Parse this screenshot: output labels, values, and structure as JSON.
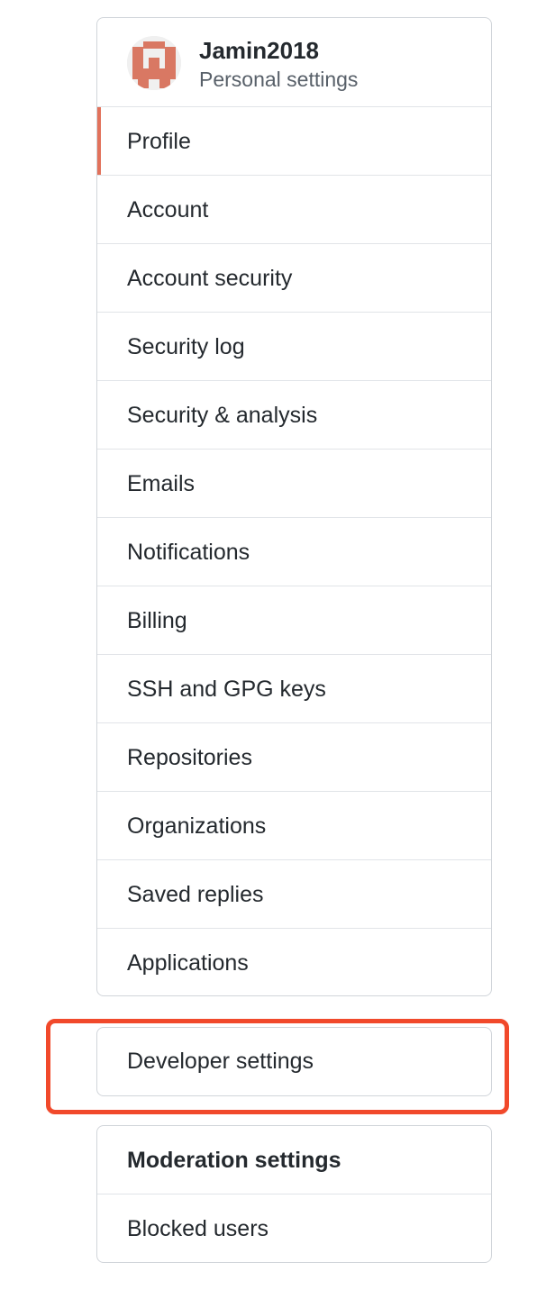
{
  "user": {
    "username": "Jamin2018",
    "subtitle": "Personal settings",
    "avatar_icon": "pixel-identicon-avatar",
    "avatar_color": "#d97863"
  },
  "nav": {
    "items": [
      {
        "label": "Profile",
        "selected": true
      },
      {
        "label": "Account"
      },
      {
        "label": "Account security"
      },
      {
        "label": "Security log"
      },
      {
        "label": "Security & analysis"
      },
      {
        "label": "Emails"
      },
      {
        "label": "Notifications"
      },
      {
        "label": "Billing"
      },
      {
        "label": "SSH and GPG keys"
      },
      {
        "label": "Repositories"
      },
      {
        "label": "Organizations"
      },
      {
        "label": "Saved replies"
      },
      {
        "label": "Applications"
      }
    ]
  },
  "developer": {
    "label": "Developer settings"
  },
  "moderation": {
    "heading": "Moderation settings",
    "items": [
      {
        "label": "Blocked users"
      }
    ]
  },
  "colors": {
    "selected_indicator": "#e2725b",
    "highlight_border": "#f1492b",
    "border": "#d1d5da"
  }
}
